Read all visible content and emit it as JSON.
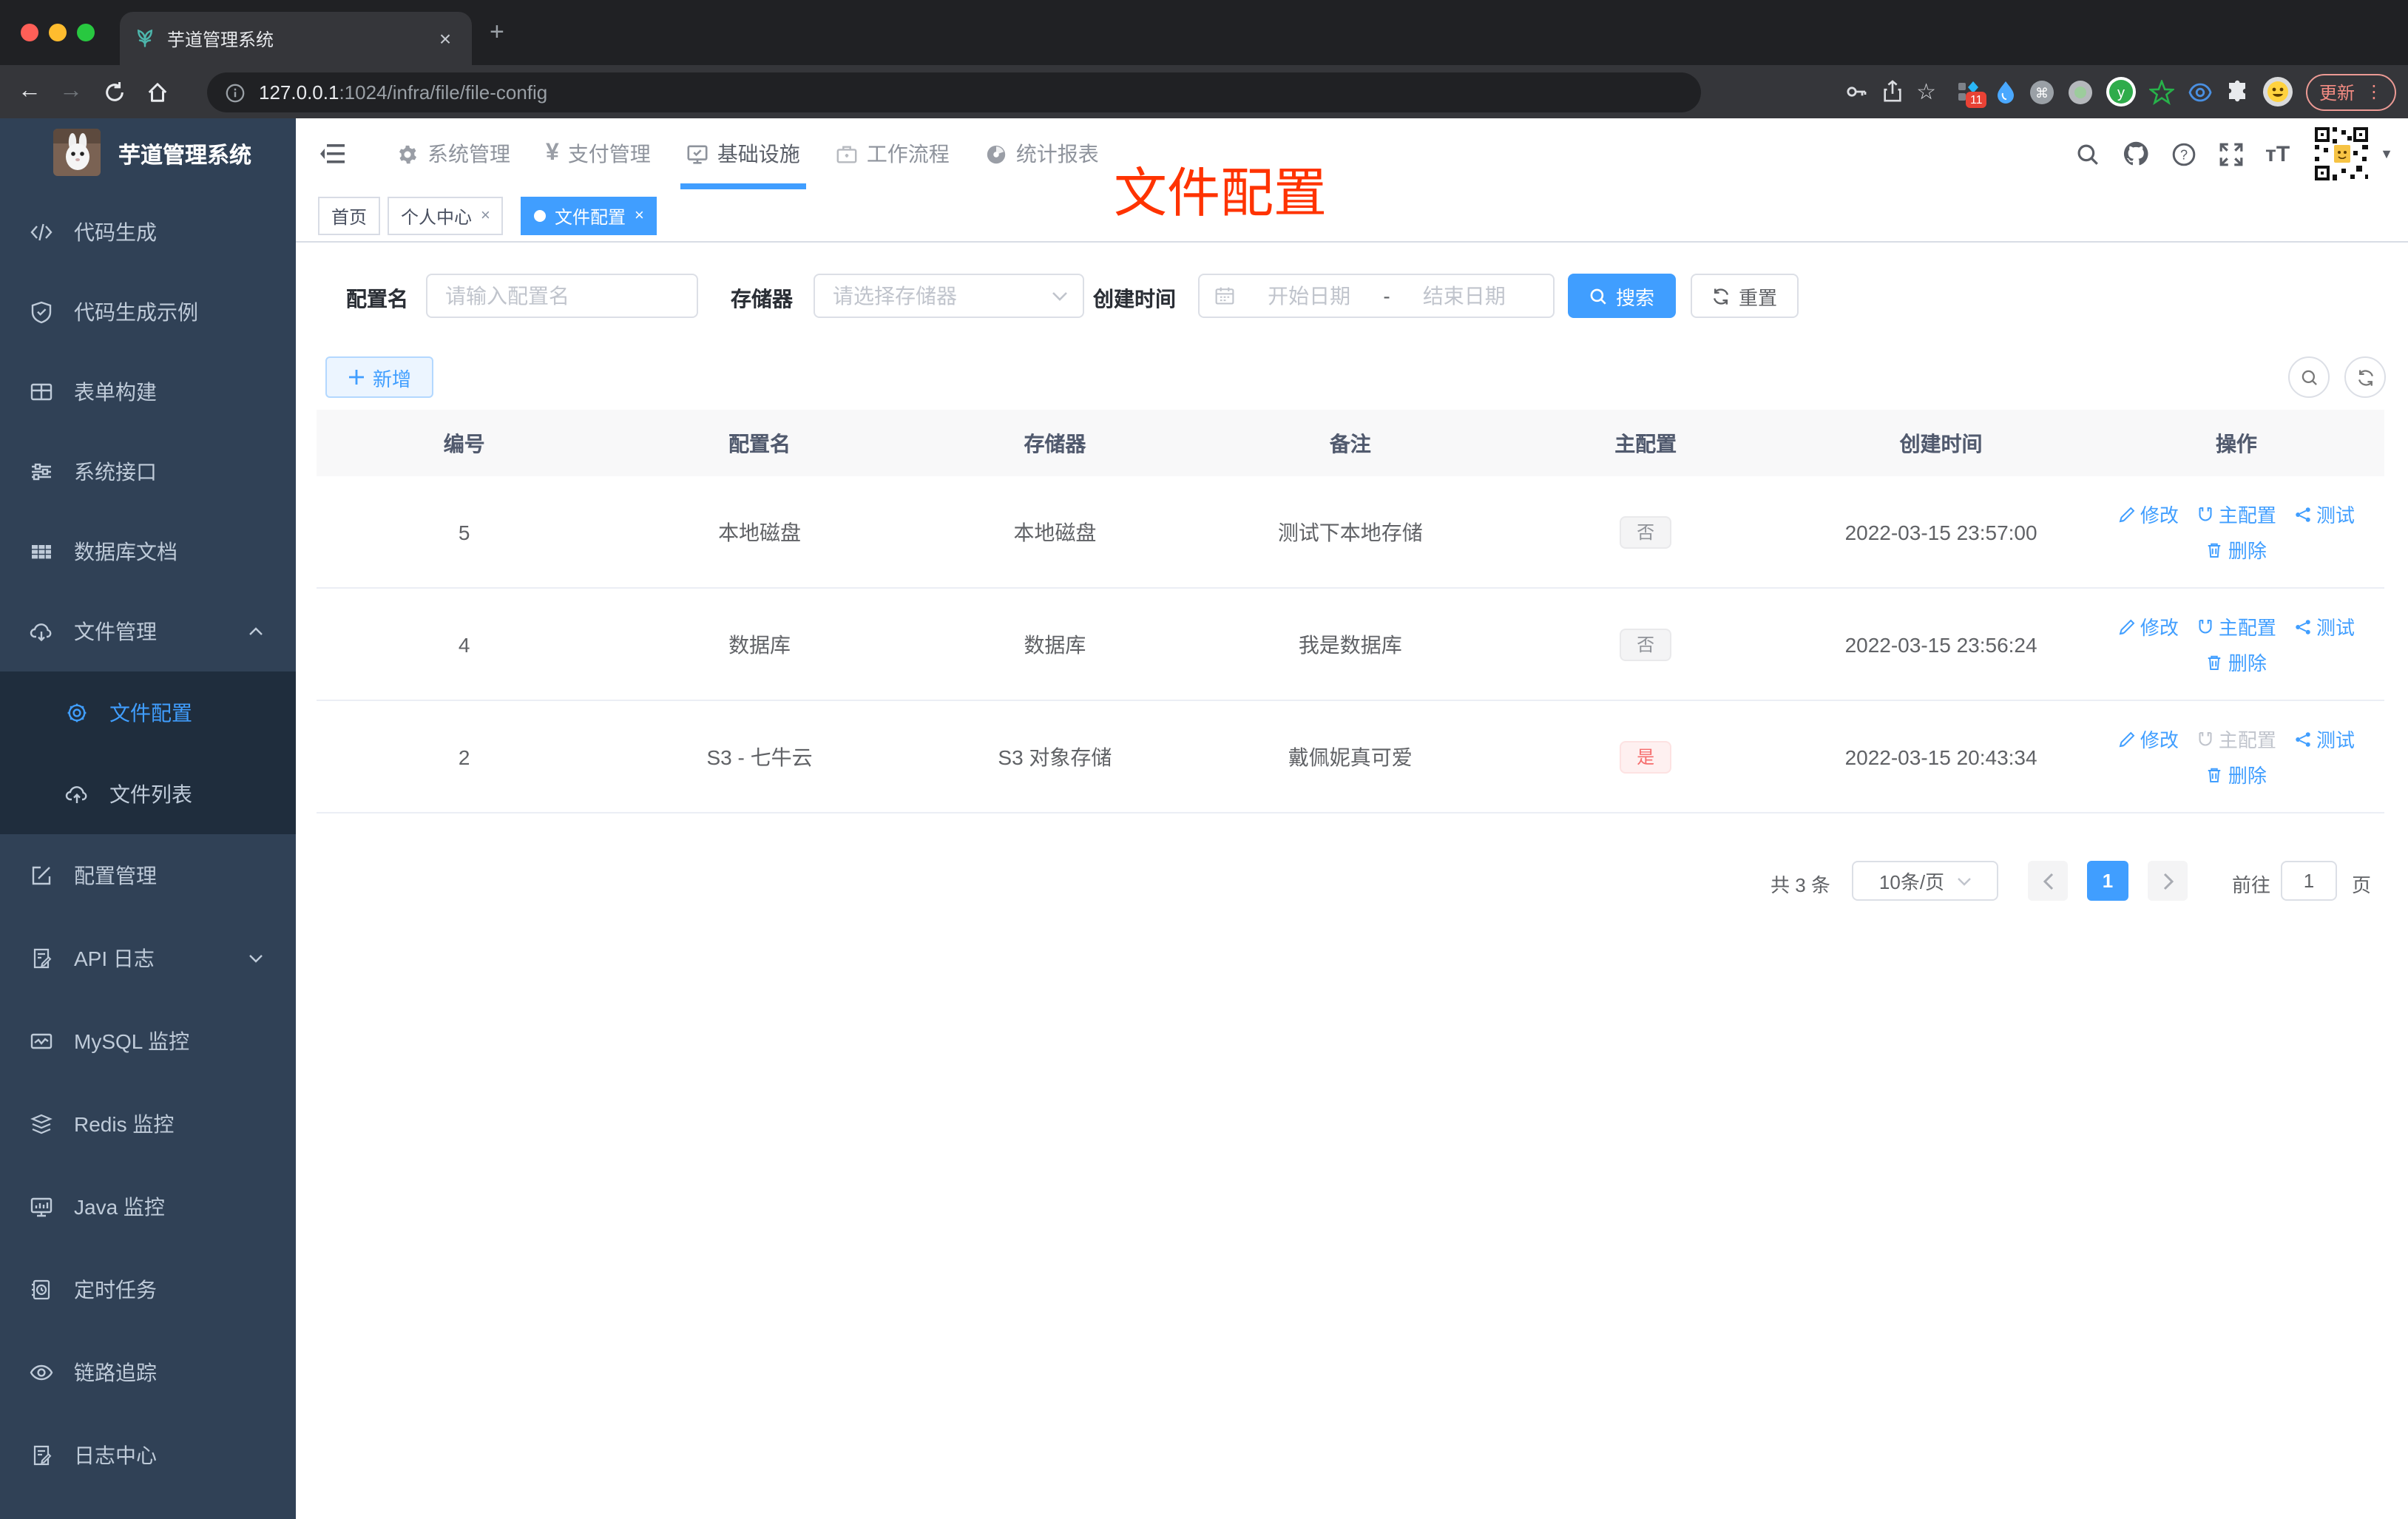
{
  "browser": {
    "tab_title": "芋道管理系统",
    "close_tab": "×",
    "new_tab": "+",
    "url_host": "127.0.0.1",
    "url_path": ":1024/infra/file/file-config",
    "extension_badge": "11",
    "update_label": "更新",
    "menu_dots": "⋮"
  },
  "sidebar": {
    "logo_title": "芋道管理系统",
    "items": [
      {
        "label": "代码生成",
        "icon": "code-icon"
      },
      {
        "label": "代码生成示例",
        "icon": "shield-check-icon"
      },
      {
        "label": "表单构建",
        "icon": "form-icon"
      },
      {
        "label": "系统接口",
        "icon": "sliders-icon"
      },
      {
        "label": "数据库文档",
        "icon": "table-icon"
      },
      {
        "label": "文件管理",
        "icon": "cloud-download-icon",
        "expanded": true
      },
      {
        "label": "文件配置",
        "icon": "gear-icon",
        "active": true,
        "submenu": true
      },
      {
        "label": "文件列表",
        "icon": "cloud-upload-icon",
        "submenu": true
      },
      {
        "label": "配置管理",
        "icon": "edit-square-icon"
      },
      {
        "label": "API 日志",
        "icon": "log-doc-icon",
        "collapsed": true
      },
      {
        "label": "MySQL 监控",
        "icon": "chart-line-icon"
      },
      {
        "label": "Redis 监控",
        "icon": "layers-icon"
      },
      {
        "label": "Java 监控",
        "icon": "monitor-icon"
      },
      {
        "label": "定时任务",
        "icon": "schedule-icon"
      },
      {
        "label": "链路追踪",
        "icon": "eye-icon"
      },
      {
        "label": "日志中心",
        "icon": "log-center-icon"
      }
    ]
  },
  "topnav": {
    "menus": [
      {
        "label": "系统管理",
        "icon": "gear-icon"
      },
      {
        "label": "支付管理",
        "icon": "yen-icon"
      },
      {
        "label": "基础设施",
        "icon": "infra-monitor-icon",
        "active": true
      },
      {
        "label": "工作流程",
        "icon": "briefcase-icon"
      },
      {
        "label": "统计报表",
        "icon": "report-icon"
      }
    ]
  },
  "tagsview": {
    "tags": [
      {
        "label": "首页"
      },
      {
        "label": "个人中心",
        "closable": true
      },
      {
        "label": "文件配置",
        "closable": true,
        "active": true
      }
    ],
    "close_glyph": "×"
  },
  "annotation": {
    "text": "文件配置",
    "color": "#ff3300"
  },
  "filter": {
    "name_label": "配置名",
    "name_placeholder": "请输入配置名",
    "storage_label": "存储器",
    "storage_placeholder": "请选择存储器",
    "date_label": "创建时间",
    "date_start_placeholder": "开始日期",
    "date_separator": "-",
    "date_end_placeholder": "结束日期",
    "search_label": "搜索",
    "reset_label": "重置"
  },
  "toolbar": {
    "add_label": "新增"
  },
  "table": {
    "headers": [
      "编号",
      "配置名",
      "存储器",
      "备注",
      "主配置",
      "创建时间",
      "操作"
    ],
    "action_labels": {
      "edit": "修改",
      "master": "主配置",
      "test": "测试",
      "delete": "删除"
    },
    "rows": [
      {
        "id": "5",
        "name": "本地磁盘",
        "storage": "本地磁盘",
        "remark": "测试下本地存储",
        "master": "否",
        "master_type": "info",
        "created": "2022-03-15 23:57:00",
        "master_action_disabled": false
      },
      {
        "id": "4",
        "name": "数据库",
        "storage": "数据库",
        "remark": "我是数据库",
        "master": "否",
        "master_type": "info",
        "created": "2022-03-15 23:56:24",
        "master_action_disabled": false
      },
      {
        "id": "2",
        "name": "S3 - 七牛云",
        "storage": "S3 对象存储",
        "remark": "戴佩妮真可爱",
        "master": "是",
        "master_type": "danger",
        "created": "2022-03-15 20:43:34",
        "master_action_disabled": true
      }
    ]
  },
  "pagination": {
    "total": "共 3 条",
    "page_size": "10条/页",
    "current_page": "1",
    "goto_label": "前往",
    "goto_value": "1",
    "page_suffix": "页"
  },
  "colors": {
    "accent": "#409eff",
    "danger": "#f56c6c",
    "sidebar_bg": "#304156",
    "submenu_bg": "#1f2d3d"
  }
}
